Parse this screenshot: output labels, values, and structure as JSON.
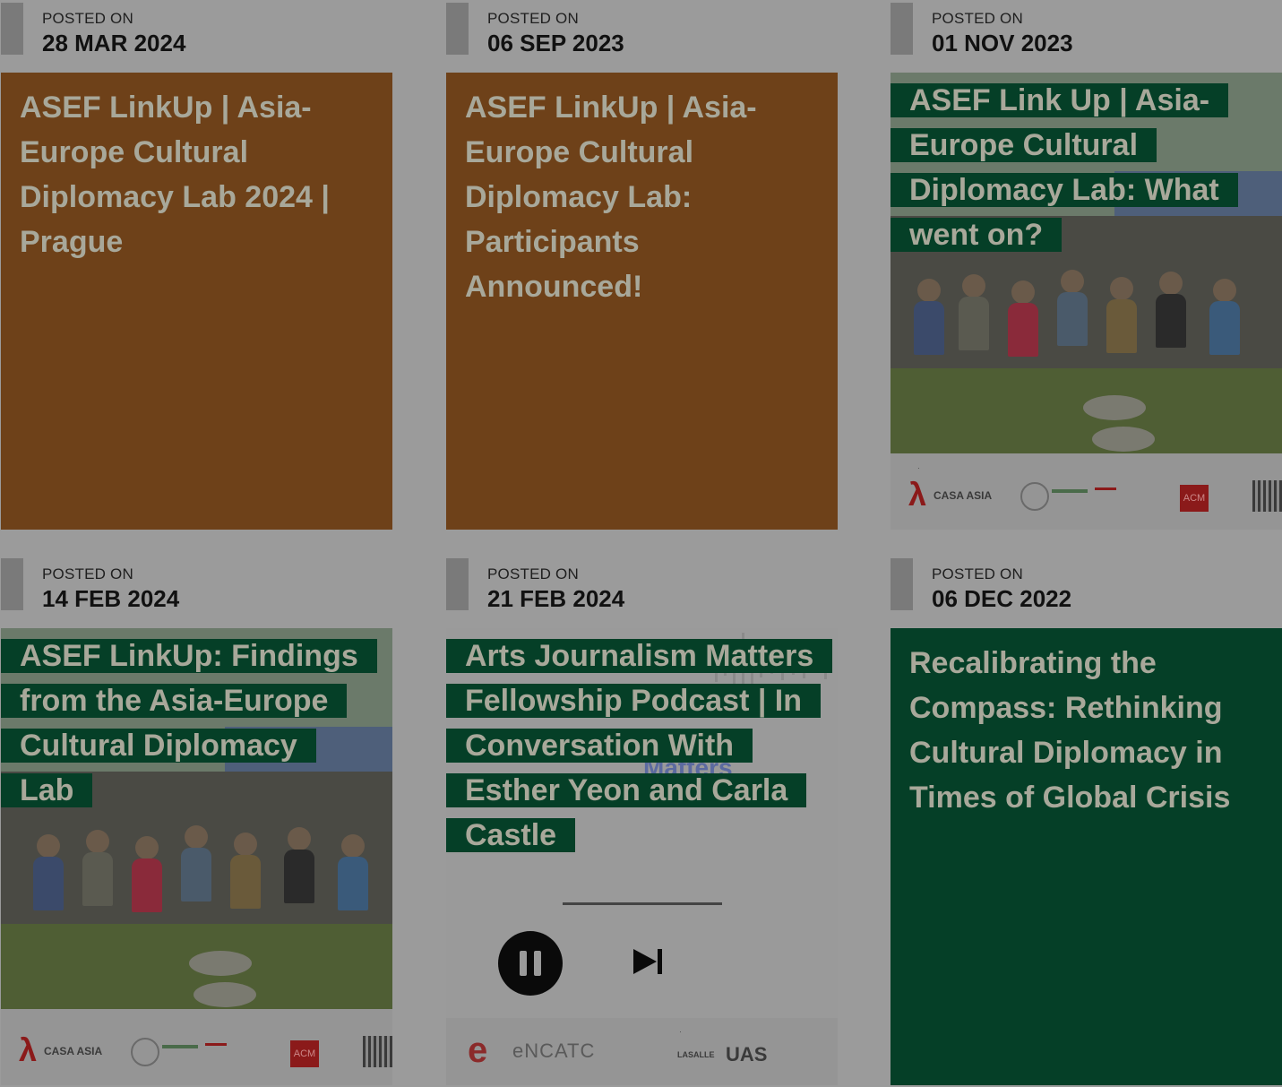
{
  "cards": [
    {
      "posted_label": "POSTED ON",
      "date": "28 MAR 2024",
      "title": "ASEF LinkUp | Asia-Europe Cultural Diplomacy Lab 2024 | Prague",
      "style": "brown"
    },
    {
      "posted_label": "POSTED ON",
      "date": "06 SEP 2023",
      "title": "ASEF LinkUp | Asia-Europe Cultural Diplomacy Lab: Participants Announced!",
      "style": "brown"
    },
    {
      "posted_label": "POSTED ON",
      "date": "01 NOV 2023",
      "title": "ASEF Link Up | Asia-Europe Cultural Diplomacy Lab: What went on?",
      "style": "photo",
      "image_logos": [
        "CASA ASIA",
        "ACM"
      ]
    },
    {
      "posted_label": "POSTED ON",
      "date": "14 FEB 2024",
      "title": "ASEF LinkUp: Findings from the Asia-Europe Cultural Diplomacy Lab",
      "style": "photo",
      "image_logos": [
        "CASA ASIA",
        "ACM"
      ]
    },
    {
      "posted_label": "POSTED ON",
      "date": "21 FEB 2024",
      "title": "Arts Journalism Matters Fellowship Podcast | In Conversation With Esther Yeon and Carla Castle",
      "style": "podcast",
      "image_logos": [
        "eNCATC",
        "LASALLE",
        "UAS"
      ],
      "image_text": "Matters"
    },
    {
      "posted_label": "POSTED ON",
      "date": "06 DEC 2022",
      "title": "Recalibrating the Compass: Rethinking Cultural Diplomacy in Times of Global Crisis",
      "style": "green"
    }
  ],
  "colors": {
    "overlay_bg": "#9b9b9b",
    "brown_panel": "#6e4119",
    "green_panel": "#053f27",
    "title_text": "#a8a89a"
  },
  "icons": [
    "pause-icon",
    "skip-next-icon"
  ]
}
